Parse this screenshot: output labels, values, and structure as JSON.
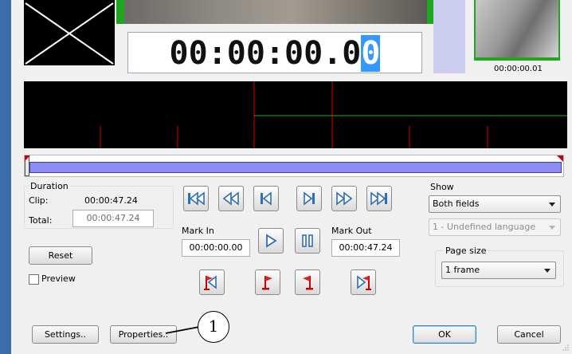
{
  "preview": {
    "timecode_prefix": "00:00:00.0",
    "timecode_selected": "0",
    "thumb_time": "00:00:00.01"
  },
  "duration": {
    "title": "Duration",
    "clip_label": "Clip:",
    "clip_value": "00:00:47.24",
    "total_label": "Total:",
    "total_value": "00:00:47.24"
  },
  "marks": {
    "in_label": "Mark In",
    "in_value": "00:00:00.00",
    "out_label": "Mark Out",
    "out_value": "00:00:47.24"
  },
  "left_controls": {
    "reset_label": "Reset",
    "preview_label": "Preview",
    "preview_checked": false
  },
  "show": {
    "title": "Show",
    "fields_value": "Both fields",
    "language_value": "1 - Undefined language"
  },
  "page_size": {
    "title": "Page size",
    "value": "1 frame"
  },
  "buttons": {
    "settings": "Settings..",
    "properties": "Properties..",
    "ok": "OK",
    "cancel": "Cancel"
  },
  "callout": {
    "number": "1"
  },
  "colors": {
    "accent_green": "#1fa51f",
    "range_bar": "#8c8cf2",
    "selection_blue": "#3399ff",
    "marker_red": "#e00000"
  },
  "icons": [
    "go-to-start-icon",
    "rewind-icon",
    "previous-frame-icon",
    "next-frame-icon",
    "fast-forward-icon",
    "go-to-end-icon",
    "play-icon",
    "pause-icon",
    "go-to-mark-in-icon",
    "set-mark-in-icon",
    "set-mark-out-icon",
    "go-to-mark-out-icon"
  ]
}
